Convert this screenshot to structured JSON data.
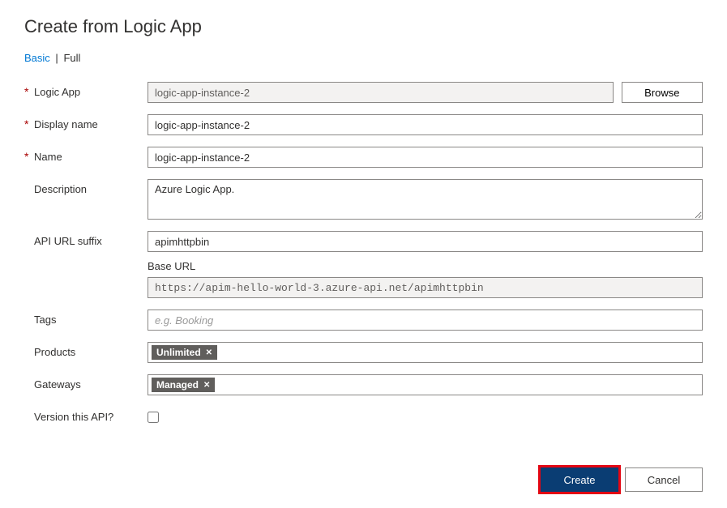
{
  "title": "Create from Logic App",
  "tabs": {
    "basic": "Basic",
    "sep": "|",
    "full": "Full"
  },
  "form": {
    "logicApp": {
      "label": "Logic App",
      "value": "logic-app-instance-2",
      "browse": "Browse"
    },
    "displayName": {
      "label": "Display name",
      "value": "logic-app-instance-2"
    },
    "name": {
      "label": "Name",
      "value": "logic-app-instance-2"
    },
    "description": {
      "label": "Description",
      "value": "Azure Logic App."
    },
    "apiSuffix": {
      "label": "API URL suffix",
      "value": "apimhttpbin"
    },
    "baseUrl": {
      "label": "Base URL",
      "value": "https://apim-hello-world-3.azure-api.net/apimhttpbin"
    },
    "tags": {
      "label": "Tags",
      "placeholder": "e.g. Booking"
    },
    "products": {
      "label": "Products",
      "chip": "Unlimited"
    },
    "gateways": {
      "label": "Gateways",
      "chip": "Managed"
    },
    "version": {
      "label": "Version this API?"
    }
  },
  "footer": {
    "create": "Create",
    "cancel": "Cancel"
  }
}
